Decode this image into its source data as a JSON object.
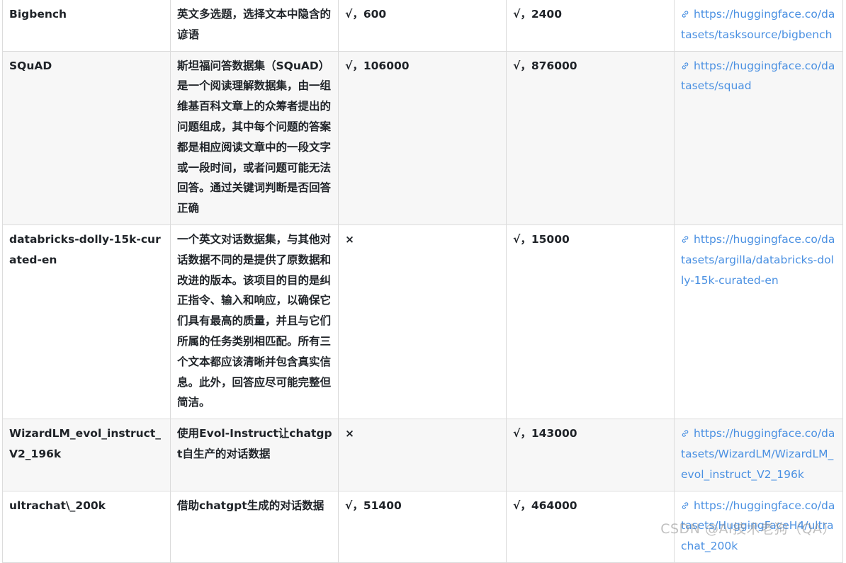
{
  "rows": [
    {
      "name": "Bigbench",
      "description": "英文多选题，选择文本中隐含的谚语",
      "eval": "√，600",
      "train": "√，2400",
      "link": "https://huggingface.co/datasets/tasksource/bigbench"
    },
    {
      "name": "SQuAD",
      "description": "斯坦福问答数据集（SQuAD）是一个阅读理解数据集，由一组维基百科文章上的众筹者提出的问题组成，其中每个问题的答案都是相应阅读文章中的一段文字或一段时间，或者问题可能无法回答。通过关键词判断是否回答正确",
      "eval": "√，106000",
      "train": "√，876000",
      "link": "https://huggingface.co/datasets/squad"
    },
    {
      "name": "databricks-dolly-15k-curated-en",
      "description": "一个英文对话数据集，与其他对话数据不同的是提供了原数据和改进的版本。该项目的目的是纠正指令、输入和响应，以确保它们具有最高的质量，并且与它们所属的任务类别相匹配。所有三个文本都应该清晰并包含真实信息。此外，回答应尽可能完整但简洁。",
      "eval": "×",
      "train": "√，15000",
      "link": "https://huggingface.co/datasets/argilla/databricks-dolly-15k-curated-en"
    },
    {
      "name": "WizardLM_evol_instruct_V2_196k",
      "description": "使用Evol-Instruct让chatgpt自生产的对话数据",
      "eval": "×",
      "train": "√，143000",
      "link": "https://huggingface.co/datasets/WizardLM/WizardLM_evol_instruct_V2_196k"
    },
    {
      "name": "ultrachat\\_200k",
      "description": "借助chatgpt生成的对话数据",
      "eval": "√，51400",
      "train": "√，464000",
      "link": "https://huggingface.co/datasets/HuggingFaceH4/ultrachat_200k"
    }
  ],
  "watermark": "CSDN @AI技术老狗（QA）",
  "colors": {
    "link": "#4a90e2",
    "border": "#dcdcdc",
    "alt_row": "#f7f7f7"
  },
  "icons": {
    "link": "link-icon"
  }
}
